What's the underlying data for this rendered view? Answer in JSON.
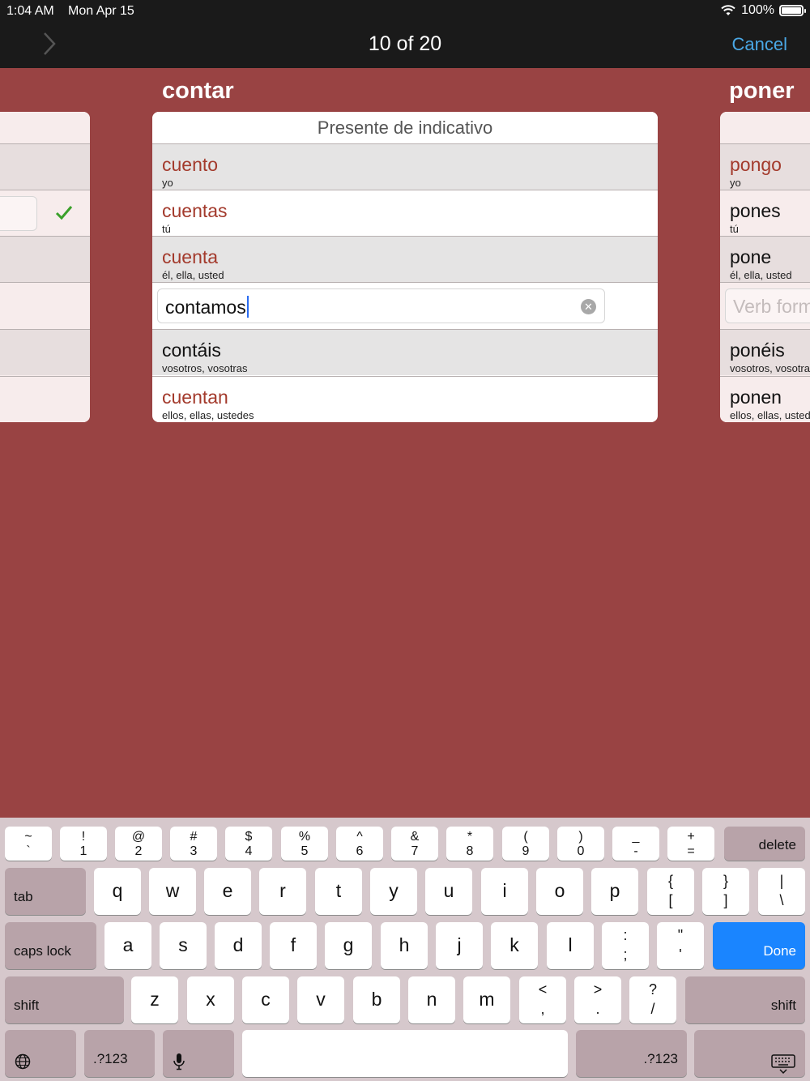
{
  "status": {
    "time": "1:04 AM",
    "date": "Mon Apr 15",
    "battery": "100%"
  },
  "nav": {
    "title": "10 of 20",
    "cancel": "Cancel"
  },
  "verbs": {
    "center": "contar",
    "right": "poner"
  },
  "center_card": {
    "header": "Presente de indicativo",
    "rows": [
      {
        "form": "cuento",
        "pronoun": "yo"
      },
      {
        "form": "cuentas",
        "pronoun": "tú"
      },
      {
        "form": "cuenta",
        "pronoun": "él, ella, usted"
      },
      {
        "input_value": "contamos"
      },
      {
        "form": "contáis",
        "pronoun": "vosotros, vosotras"
      },
      {
        "form": "cuentan",
        "pronoun": "ellos, ellas, ustedes"
      }
    ]
  },
  "right_card": {
    "rows": [
      {
        "form": "pongo",
        "pronoun": "yo"
      },
      {
        "form": "pones",
        "pronoun": "tú"
      },
      {
        "form": "pone",
        "pronoun": "él, ella, usted"
      },
      {
        "placeholder": "Verb form"
      },
      {
        "form": "ponéis",
        "pronoun": "vosotros, vosotras"
      },
      {
        "form": "ponen",
        "pronoun": "ellos, ellas, ustedes"
      }
    ]
  },
  "keyboard": {
    "row1": [
      {
        "top": "~",
        "bot": "`"
      },
      {
        "top": "!",
        "bot": "1"
      },
      {
        "top": "@",
        "bot": "2"
      },
      {
        "top": "#",
        "bot": "3"
      },
      {
        "top": "$",
        "bot": "4"
      },
      {
        "top": "%",
        "bot": "5"
      },
      {
        "top": "^",
        "bot": "6"
      },
      {
        "top": "&",
        "bot": "7"
      },
      {
        "top": "*",
        "bot": "8"
      },
      {
        "top": "(",
        "bot": "9"
      },
      {
        "top": ")",
        "bot": "0"
      },
      {
        "top": "_",
        "bot": "-"
      },
      {
        "top": "+",
        "bot": "="
      }
    ],
    "delete": "delete",
    "tab": "tab",
    "row2": [
      "q",
      "w",
      "e",
      "r",
      "t",
      "y",
      "u",
      "i",
      "o",
      "p"
    ],
    "row2_sym": [
      {
        "top": "{",
        "bot": "["
      },
      {
        "top": "}",
        "bot": "]"
      },
      {
        "top": "|",
        "bot": "\\"
      }
    ],
    "caps": "caps lock",
    "row3": [
      "a",
      "s",
      "d",
      "f",
      "g",
      "h",
      "j",
      "k",
      "l"
    ],
    "row3_sym": [
      {
        "top": ":",
        "bot": ";"
      },
      {
        "top": "\"",
        "bot": "'"
      }
    ],
    "done": "Done",
    "shift": "shift",
    "row4": [
      "z",
      "x",
      "c",
      "v",
      "b",
      "n",
      "m"
    ],
    "row4_sym": [
      {
        "top": "<",
        "bot": ","
      },
      {
        "top": ">",
        "bot": "."
      },
      {
        "top": "?",
        "bot": "/"
      }
    ],
    "num_key": ".?123"
  },
  "colors": {
    "background": "#994343",
    "accent_red": "#a33a2c",
    "done_blue": "#1a85ff",
    "cancel_blue": "#4aa8e6"
  }
}
